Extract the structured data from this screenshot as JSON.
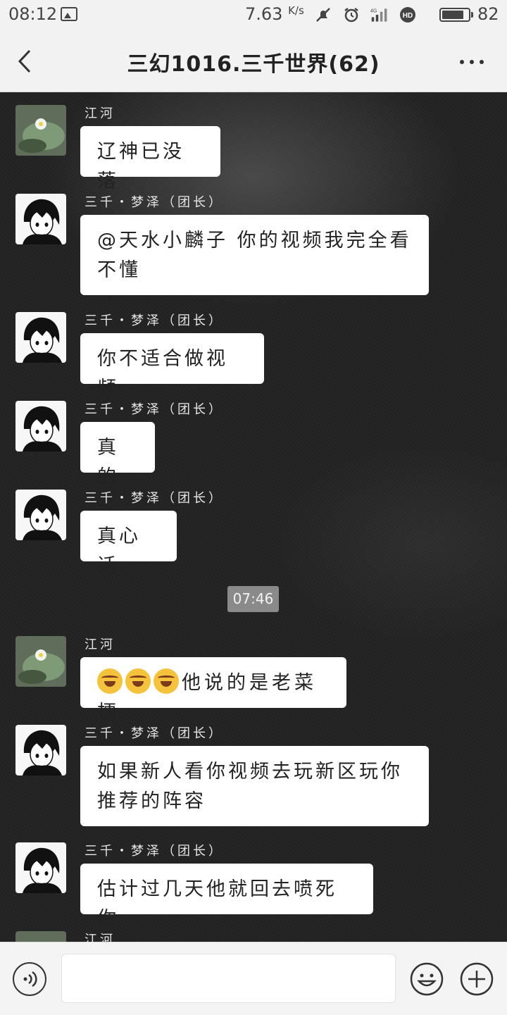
{
  "status_bar": {
    "time": "08:12",
    "speed": "7.63",
    "speed_unit": "K/s",
    "network": "4G",
    "battery": "82",
    "battery_level": 0.82
  },
  "header": {
    "title": "三幻1016.三千世界(62)"
  },
  "messages": [
    {
      "sender": "江河",
      "avatar": "lotus-leaf",
      "text": "辽神已没落"
    },
    {
      "sender": "三千・梦泽（团长）",
      "avatar": "anime-boy",
      "text": "@天水小麟子  你的视频我完全看不懂"
    },
    {
      "sender": "三千・梦泽（团长）",
      "avatar": "anime-boy",
      "text": "你不适合做视频"
    },
    {
      "sender": "三千・梦泽（团长）",
      "avatar": "anime-boy",
      "text": "真的"
    },
    {
      "sender": "三千・梦泽（团长）",
      "avatar": "anime-boy",
      "text": "真心话"
    },
    {
      "sender": "江河",
      "avatar": "lotus-leaf",
      "emoji": "crying-laughing",
      "emoji_count": 3,
      "text": "他说的是老菜梗"
    },
    {
      "sender": "三千・梦泽（团长）",
      "avatar": "anime-boy",
      "text": "如果新人看你视频去玩新区玩你推荐的阵容"
    },
    {
      "sender": "三千・梦泽（团长）",
      "avatar": "anime-boy",
      "text": "估计过几天他就回去喷死你"
    },
    {
      "sender": "江河",
      "avatar": "lotus-leaf"
    }
  ],
  "time_divider": "07:46",
  "icons": {
    "back": "chevron-left-icon",
    "more": "more-dots-icon",
    "voice": "voice-icon",
    "emoji": "smiley-icon",
    "plus": "plus-circle-icon"
  },
  "colors": {
    "bar_bg": "#f2f2f2",
    "chat_bg": "#232323",
    "bubble": "#ffffff"
  }
}
